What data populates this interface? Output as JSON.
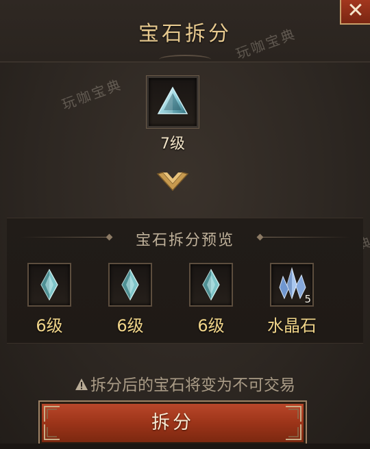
{
  "dialog": {
    "title": "宝石拆分",
    "close_label": "✕"
  },
  "watermark": {
    "text": "玩咖宝典"
  },
  "source_gem": {
    "icon": "triangle-gem-icon",
    "level_label": "7级"
  },
  "preview": {
    "title": "宝石拆分预览",
    "items": [
      {
        "icon": "gem-icon",
        "label": "6级"
      },
      {
        "icon": "gem-icon",
        "label": "6级"
      },
      {
        "icon": "gem-icon",
        "label": "6级"
      },
      {
        "icon": "crystal-icon",
        "label": "水晶石",
        "count": "5"
      }
    ]
  },
  "warning": {
    "icon": "warning-icon",
    "text": "拆分后的宝石将变为不可交易"
  },
  "confirm_button": {
    "label": "拆分"
  },
  "colors": {
    "accent_gold": "#f1d58a",
    "title_gold": "#e7c98f",
    "button_red": "#9c3419",
    "background": "#2d2722"
  }
}
